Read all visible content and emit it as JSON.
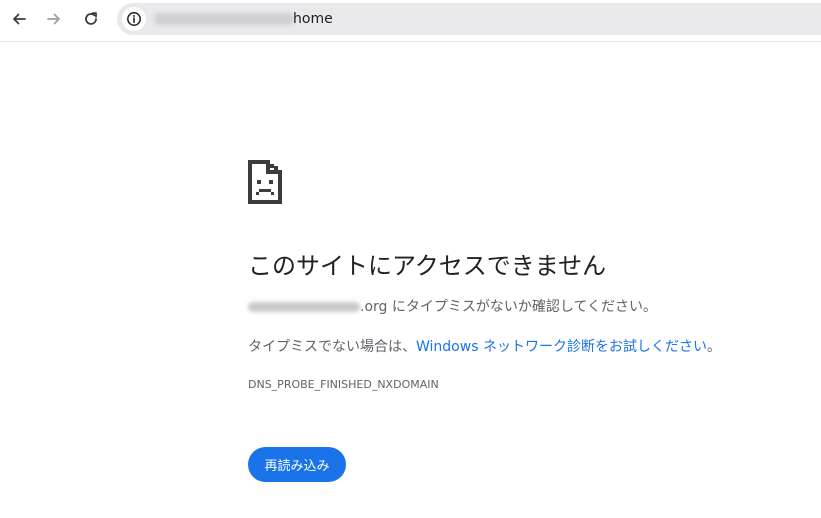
{
  "browser": {
    "url_visible_text": "home",
    "icons": {
      "back": "arrow-left-icon",
      "forward": "arrow-right-icon",
      "reload": "reload-icon",
      "site_info": "info-icon"
    }
  },
  "error_page": {
    "headline": "このサイトにアクセスできません",
    "line1_domain_suffix": ".org",
    "line1_text": " にタイプミスがないか確認してください。",
    "line2_prefix": "タイプミスでない場合は、",
    "line2_link": "Windows ネットワーク診断をお試しください",
    "line2_suffix": "。",
    "error_code": "DNS_PROBE_FINISHED_NXDOMAIN",
    "reload_button": "再読み込み",
    "icon": "sad-page-icon"
  },
  "colors": {
    "accent": "#1a73e8",
    "text_primary": "#202124",
    "text_secondary": "#5f6368",
    "omnibox_bg": "#e9e9ec"
  }
}
